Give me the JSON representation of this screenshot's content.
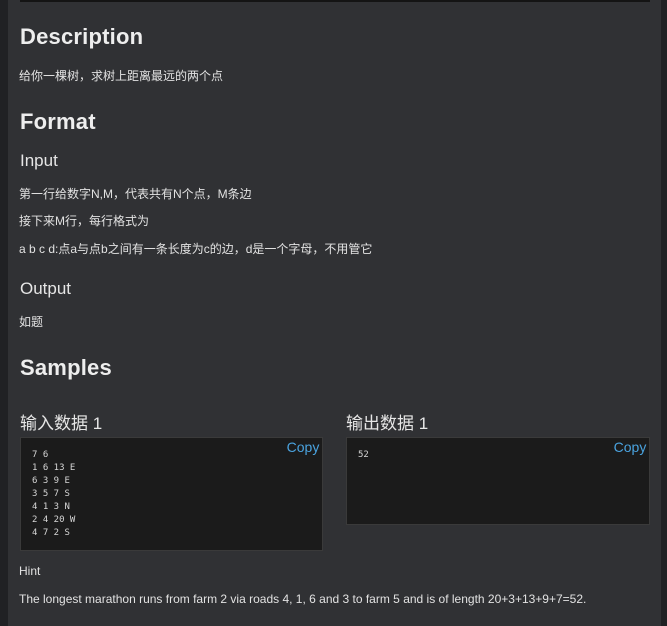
{
  "description": {
    "heading": "Description",
    "text": "给你一棵树，求树上距离最远的两个点"
  },
  "format": {
    "heading": "Format",
    "input_heading": "Input",
    "input_lines": [
      "第一行给数字N,M，代表共有N个点，M条边",
      "接下来M行，每行格式为",
      "a b c d:点a与点b之间有一条长度为c的边，d是一个字母，不用管它"
    ],
    "output_heading": "Output",
    "output_text": "如题"
  },
  "samples": {
    "heading": "Samples",
    "input_title": "输入数据 1",
    "output_title": "输出数据 1",
    "copy_label": "Copy",
    "input_data": "7 6\n1 6 13 E\n6 3 9 E\n3 5 7 S\n4 1 3 N\n2 4 20 W\n4 7 2 S",
    "output_data": "52"
  },
  "hint": {
    "heading": "Hint",
    "text": "The longest marathon runs from farm 2 via roads 4, 1, 6 and 3 to farm 5 and is of length 20+3+13+9+7=52."
  },
  "colors": {
    "page_background": "#303134",
    "code_background": "#1b1b1b",
    "copy_link": "#4aa3df"
  }
}
